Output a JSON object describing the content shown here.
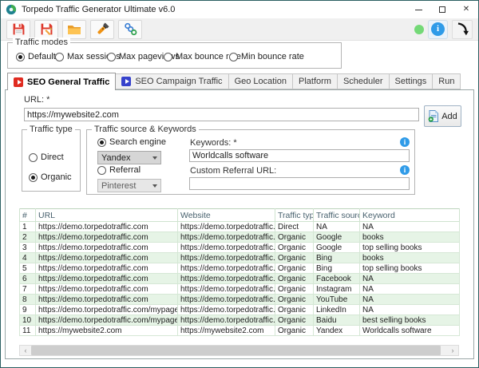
{
  "window": {
    "title": "Torpedo Traffic Generator Ultimate v6.0"
  },
  "toolbar": {
    "buttons": [
      "save",
      "save-as",
      "open-folder",
      "flashlight",
      "share"
    ],
    "status_color": "#74d977"
  },
  "traffic_modes": {
    "label": "Traffic modes",
    "options": [
      {
        "label": "Default",
        "selected": true
      },
      {
        "label": "Max sessions",
        "selected": false
      },
      {
        "label": "Max pageviews",
        "selected": false
      },
      {
        "label": "Max bounce rate",
        "selected": false
      },
      {
        "label": "Min bounce rate",
        "selected": false
      }
    ]
  },
  "tabs": [
    {
      "label": "SEO General Traffic",
      "active": true,
      "icon": "play",
      "icon_color": "#e02b20"
    },
    {
      "label": "SEO Campaign Traffic",
      "active": false,
      "icon": "play",
      "icon_color": "#3642cc"
    },
    {
      "label": "Geo Location",
      "active": false
    },
    {
      "label": "Platform",
      "active": false
    },
    {
      "label": "Scheduler",
      "active": false
    },
    {
      "label": "Settings",
      "active": false
    },
    {
      "label": "Run",
      "active": false
    }
  ],
  "form": {
    "url_label": "URL: *",
    "url_value": "https://mywebsite2.com",
    "add_label": "Add",
    "traffic_type": {
      "label": "Traffic type",
      "direct_label": "Direct",
      "direct_selected": false,
      "organic_label": "Organic",
      "organic_selected": true
    },
    "traffic_source": {
      "label": "Traffic source & Keywords",
      "search_engine_label": "Search engine",
      "search_engine_selected": true,
      "search_engine_value": "Yandex",
      "keywords_label": "Keywords: *",
      "keywords_value": "Worldcalls software",
      "referral_label": "Referral",
      "referral_selected": false,
      "referral_value": "Pinterest",
      "custom_referral_label": "Custom Referral URL:",
      "custom_referral_value": ""
    }
  },
  "table": {
    "columns": [
      "#",
      "URL",
      "Website",
      "Traffic type",
      "Traffic source",
      "Keyword"
    ],
    "rows": [
      [
        "1",
        "https://demo.torpedotraffic.com",
        "https://demo.torpedotraffic.com",
        "Direct",
        "NA",
        "NA"
      ],
      [
        "2",
        "https://demo.torpedotraffic.com",
        "https://demo.torpedotraffic.com",
        "Organic",
        "Google",
        "books"
      ],
      [
        "3",
        "https://demo.torpedotraffic.com",
        "https://demo.torpedotraffic.com",
        "Organic",
        "Google",
        "top selling books"
      ],
      [
        "4",
        "https://demo.torpedotraffic.com",
        "https://demo.torpedotraffic.com",
        "Organic",
        "Bing",
        "books"
      ],
      [
        "5",
        "https://demo.torpedotraffic.com",
        "https://demo.torpedotraffic.com",
        "Organic",
        "Bing",
        "top selling books"
      ],
      [
        "6",
        "https://demo.torpedotraffic.com",
        "https://demo.torpedotraffic.com",
        "Organic",
        "Facebook",
        "NA"
      ],
      [
        "7",
        "https://demo.torpedotraffic.com",
        "https://demo.torpedotraffic.com",
        "Organic",
        "Instagram",
        "NA"
      ],
      [
        "8",
        "https://demo.torpedotraffic.com",
        "https://demo.torpedotraffic.com",
        "Organic",
        "YouTube",
        "NA"
      ],
      [
        "9",
        "https://demo.torpedotraffic.com/mypage.html",
        "https://demo.torpedotraffic.com",
        "Organic",
        "LinkedIn",
        "NA"
      ],
      [
        "10",
        "https://demo.torpedotraffic.com/mypage.html",
        "https://demo.torpedotraffic.com",
        "Organic",
        "Baidu",
        "best selling books"
      ],
      [
        "11",
        "https://mywebsite2.com",
        "https://mywebsite2.com",
        "Organic",
        "Yandex",
        "Worldcalls software"
      ]
    ],
    "alt_row_color": "#e6f4e6"
  },
  "colors": {
    "window_border": "#2b5e61",
    "accent_blue": "#2f9be8",
    "row_green": "#e6f4e6"
  }
}
